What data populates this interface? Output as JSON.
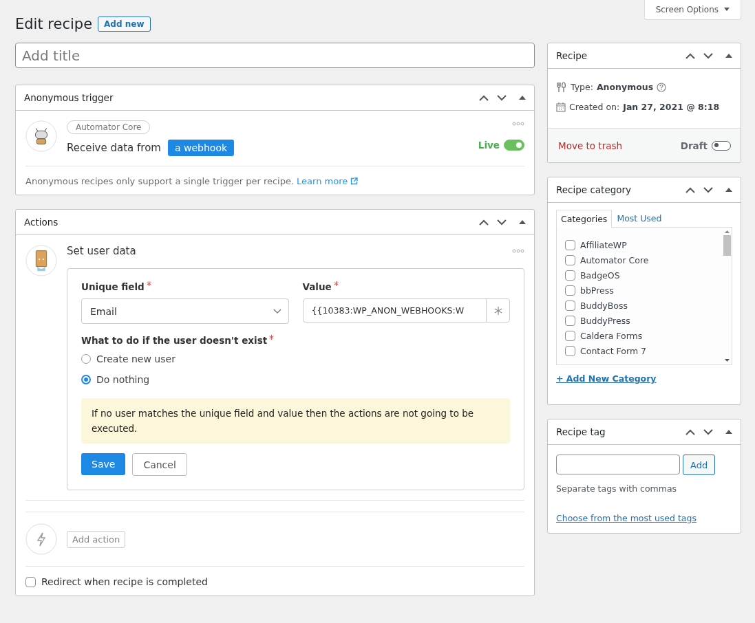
{
  "screen_options": {
    "label": "Screen Options"
  },
  "header": {
    "title": "Edit recipe",
    "add_new": "Add new"
  },
  "title_field": {
    "placeholder": "Add title"
  },
  "trigger_panel": {
    "title": "Anonymous trigger",
    "integration": "Automator Core",
    "sentence": "Receive data from",
    "token": "a webhook",
    "status_label": "Live",
    "live": true,
    "note": "Anonymous recipes only support a single trigger per recipe.",
    "link": "Learn more"
  },
  "actions_panel": {
    "title": "Actions",
    "action_title": "Set user data",
    "fields": [
      {
        "label": "Unique field",
        "required": true,
        "kind": "select",
        "value": "Email"
      },
      {
        "label": "Value",
        "required": true,
        "kind": "token",
        "value": "{{10383:WP_ANON_WEBHOOKS:W"
      }
    ],
    "question": {
      "label": "What to do if the user doesn't exist",
      "required": true
    },
    "options": [
      {
        "label": "Create new user",
        "selected": false
      },
      {
        "label": "Do nothing",
        "selected": true
      }
    ],
    "notice": "If no user matches the unique field and value then the actions are not going to be executed.",
    "save": "Save",
    "cancel": "Cancel",
    "add_action": "Add action",
    "redirect": {
      "label": "Redirect when recipe is completed",
      "checked": false
    }
  },
  "recipe_box": {
    "title": "Recipe",
    "type_label": "Type:",
    "type_value": "Anonymous",
    "created_label": "Created on:",
    "created_value": "Jan 27, 2021 @ 8:18",
    "trash": "Move to trash",
    "status_label": "Draft",
    "live": false
  },
  "category_box": {
    "title": "Recipe category",
    "tabs": [
      {
        "label": "Categories",
        "selected": true
      },
      {
        "label": "Most Used",
        "selected": false
      }
    ],
    "categories": [
      {
        "label": "AffiliateWP",
        "checked": false
      },
      {
        "label": "Automator Core",
        "checked": false
      },
      {
        "label": "BadgeOS",
        "checked": false
      },
      {
        "label": "bbPress",
        "checked": false
      },
      {
        "label": "BuddyBoss",
        "checked": false
      },
      {
        "label": "BuddyPress",
        "checked": false
      },
      {
        "label": "Caldera Forms",
        "checked": false
      },
      {
        "label": "Contact Form 7",
        "checked": false
      }
    ],
    "add_link": "+ Add New Category"
  },
  "tag_box": {
    "title": "Recipe tag",
    "add": "Add",
    "hint": "Separate tags with commas",
    "link": "Choose from the most used tags"
  }
}
